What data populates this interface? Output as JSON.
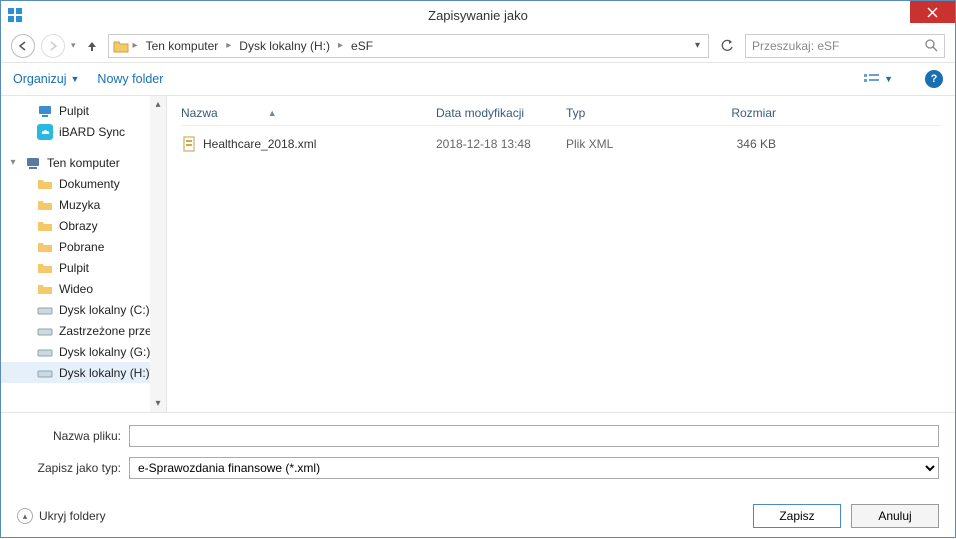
{
  "window": {
    "title": "Zapisywanie jako"
  },
  "breadcrumb": {
    "root": "Ten komputer",
    "drive": "Dysk lokalny (H:)",
    "folder": "eSF"
  },
  "search": {
    "placeholder": "Przeszukaj: eSF"
  },
  "toolbar": {
    "organize": "Organizuj",
    "new_folder": "Nowy folder"
  },
  "tree": {
    "quick": [
      {
        "label": "Pulpit"
      },
      {
        "label": "iBARD Sync"
      }
    ],
    "computer_label": "Ten komputer",
    "computer_children": [
      {
        "label": "Dokumenty"
      },
      {
        "label": "Muzyka"
      },
      {
        "label": "Obrazy"
      },
      {
        "label": "Pobrane"
      },
      {
        "label": "Pulpit"
      },
      {
        "label": "Wideo"
      },
      {
        "label": "Dysk lokalny (C:)"
      },
      {
        "label": "Zastrzeżone prze"
      },
      {
        "label": "Dysk lokalny (G:)"
      },
      {
        "label": "Dysk lokalny (H:)"
      }
    ]
  },
  "columns": {
    "name": "Nazwa",
    "date": "Data modyfikacji",
    "type": "Typ",
    "size": "Rozmiar"
  },
  "files": [
    {
      "name": "Healthcare_2018.xml",
      "date": "2018-12-18 13:48",
      "type": "Plik XML",
      "size": "346 KB"
    }
  ],
  "form": {
    "filename_label": "Nazwa pliku:",
    "filename_value": "",
    "filetype_label": "Zapisz jako typ:",
    "filetype_value": "e-Sprawozdania finansowe (*.xml)"
  },
  "footer": {
    "hide_folders": "Ukryj foldery",
    "save": "Zapisz",
    "cancel": "Anuluj"
  }
}
